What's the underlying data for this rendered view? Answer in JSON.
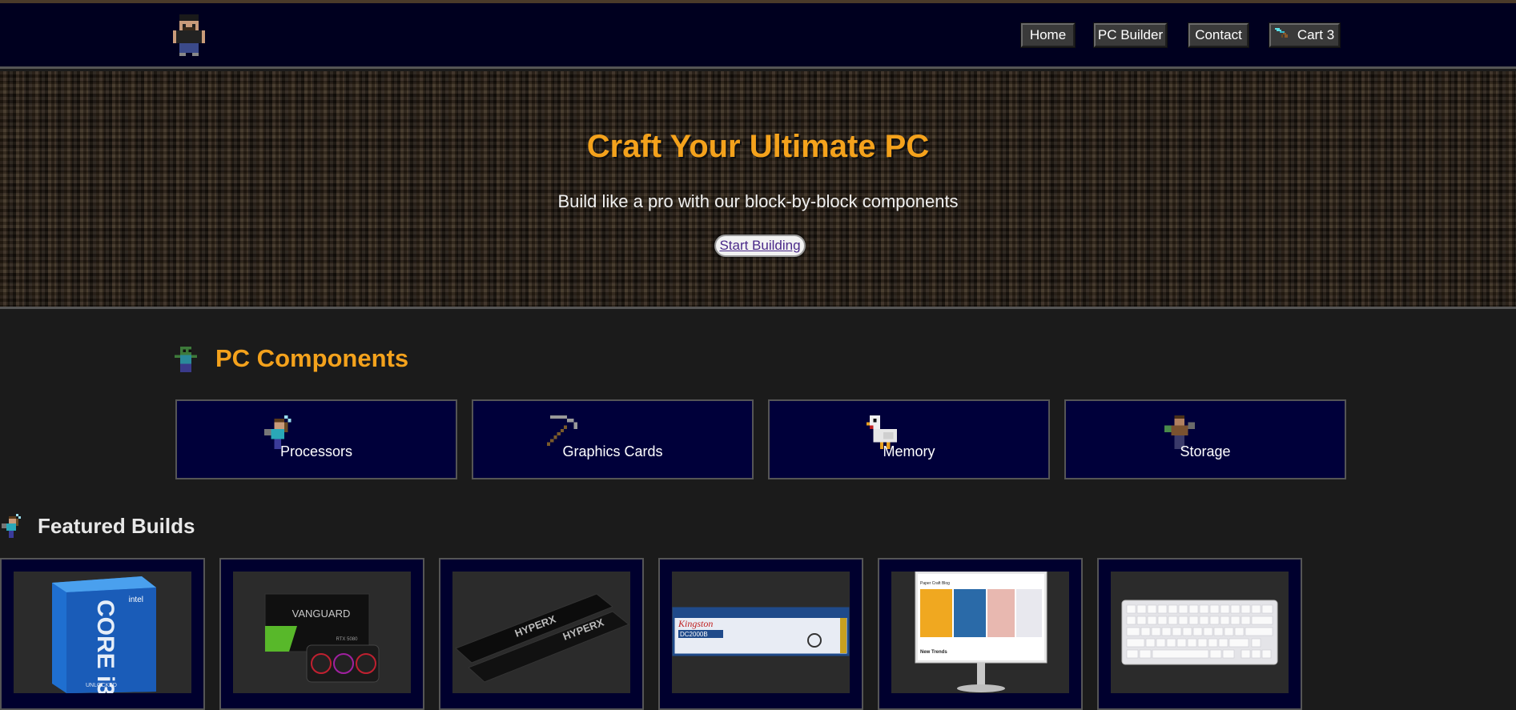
{
  "header": {
    "logo_icon": "pixel-character-logo-icon",
    "nav": [
      {
        "label": "Home"
      },
      {
        "label": "PC Builder"
      },
      {
        "label": "Contact"
      },
      {
        "label": "Cart",
        "count": "3",
        "icon": "diamond-sword-icon"
      }
    ]
  },
  "hero": {
    "title": "Craft Your Ultimate PC",
    "subtitle": "Build like a pro with our block-by-block components",
    "cta_label": "Start Building"
  },
  "components": {
    "title": "PC Components",
    "icon": "zombie-icon",
    "categories": [
      {
        "label": "Processors",
        "icon": "steve-with-sword-icon"
      },
      {
        "label": "Graphics Cards",
        "icon": "pickaxe-icon"
      },
      {
        "label": "Memory",
        "icon": "chicken-icon"
      },
      {
        "label": "Storage",
        "icon": "villager-icon"
      }
    ]
  },
  "featured": {
    "title": "Featured Builds",
    "icon": "steve-with-sword-icon",
    "items": [
      {
        "image": "intel-core-i3-box-image",
        "text": "CORE i3",
        "badge": "intel",
        "sub": "UNLOCKED"
      },
      {
        "image": "graphics-card-box-image",
        "text": "VANGUARD",
        "sub": "RTX 5080"
      },
      {
        "image": "ram-sticks-image",
        "text": "HYPERX"
      },
      {
        "image": "ssd-stick-image",
        "text": "Kingston",
        "sub": "DC2000B"
      },
      {
        "image": "monitor-image",
        "text": "Paper Craft Blog",
        "sub": "New Trends"
      },
      {
        "image": "keyboard-image"
      }
    ]
  },
  "colors": {
    "accent": "#f4a21c",
    "header_bg": "#00001f",
    "card_bg": "#00003a",
    "page_bg": "#1b1b1b"
  }
}
